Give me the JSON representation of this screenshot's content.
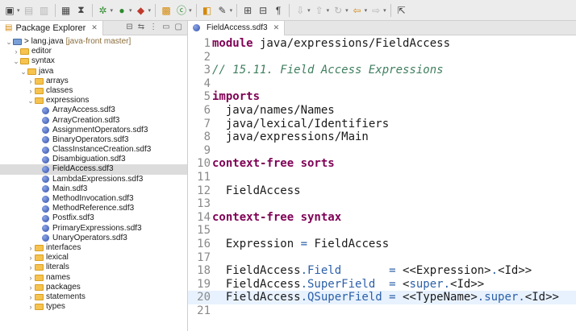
{
  "toolbar": {
    "icons": [
      "new-icon",
      "save-icon",
      "print-icon",
      "terminal-icon",
      "debug-icon",
      "run-icon",
      "external-tools-icon",
      "new-package-icon",
      "new-class-icon",
      "search-icon",
      "pen-icon",
      "open-type-icon",
      "toggle-icon",
      "pilcrow-icon",
      "annotation-icon",
      "back-icon",
      "forward-icon",
      "pin-icon"
    ]
  },
  "left_panel": {
    "tab_label": "Package Explorer",
    "tree": [
      {
        "depth": 0,
        "twisty": "v",
        "icon": "project",
        "label": "> lang.java",
        "extra": "[java-front master]"
      },
      {
        "depth": 1,
        "twisty": ">",
        "icon": "folder",
        "label": "editor"
      },
      {
        "depth": 1,
        "twisty": "v",
        "icon": "folder",
        "label": "syntax"
      },
      {
        "depth": 2,
        "twisty": "v",
        "icon": "folder",
        "label": "java"
      },
      {
        "depth": 3,
        "twisty": ">",
        "icon": "folder",
        "label": "arrays"
      },
      {
        "depth": 3,
        "twisty": ">",
        "icon": "folder",
        "label": "classes"
      },
      {
        "depth": 3,
        "twisty": "v",
        "icon": "folder",
        "label": "expressions"
      },
      {
        "depth": 4,
        "twisty": "",
        "icon": "sdf",
        "label": "ArrayAccess.sdf3"
      },
      {
        "depth": 4,
        "twisty": "",
        "icon": "sdf",
        "label": "ArrayCreation.sdf3"
      },
      {
        "depth": 4,
        "twisty": "",
        "icon": "sdf",
        "label": "AssignmentOperators.sdf3"
      },
      {
        "depth": 4,
        "twisty": "",
        "icon": "sdf",
        "label": "BinaryOperators.sdf3"
      },
      {
        "depth": 4,
        "twisty": "",
        "icon": "sdf",
        "label": "ClassInstanceCreation.sdf3"
      },
      {
        "depth": 4,
        "twisty": "",
        "icon": "sdf",
        "label": "Disambiguation.sdf3"
      },
      {
        "depth": 4,
        "twisty": "",
        "icon": "sdf",
        "label": "FieldAccess.sdf3",
        "selected": true
      },
      {
        "depth": 4,
        "twisty": "",
        "icon": "sdf",
        "label": "LambdaExpressions.sdf3"
      },
      {
        "depth": 4,
        "twisty": "",
        "icon": "sdf",
        "label": "Main.sdf3"
      },
      {
        "depth": 4,
        "twisty": "",
        "icon": "sdf",
        "label": "MethodInvocation.sdf3"
      },
      {
        "depth": 4,
        "twisty": "",
        "icon": "sdf",
        "label": "MethodReference.sdf3"
      },
      {
        "depth": 4,
        "twisty": "",
        "icon": "sdf",
        "label": "Postfix.sdf3"
      },
      {
        "depth": 4,
        "twisty": "",
        "icon": "sdf",
        "label": "PrimaryExpressions.sdf3"
      },
      {
        "depth": 4,
        "twisty": "",
        "icon": "sdf",
        "label": "UnaryOperators.sdf3"
      },
      {
        "depth": 3,
        "twisty": ">",
        "icon": "folder",
        "label": "interfaces"
      },
      {
        "depth": 3,
        "twisty": ">",
        "icon": "folder",
        "label": "lexical"
      },
      {
        "depth": 3,
        "twisty": ">",
        "icon": "folder",
        "label": "literals"
      },
      {
        "depth": 3,
        "twisty": ">",
        "icon": "folder",
        "label": "names"
      },
      {
        "depth": 3,
        "twisty": ">",
        "icon": "folder",
        "label": "packages"
      },
      {
        "depth": 3,
        "twisty": ">",
        "icon": "folder",
        "label": "statements"
      },
      {
        "depth": 3,
        "twisty": ">",
        "icon": "folder",
        "label": "types"
      }
    ]
  },
  "editor": {
    "tab_label": "FieldAccess.sdf3",
    "current_line": 20,
    "lines": [
      {
        "n": "1",
        "parts": [
          {
            "t": "module",
            "c": "kw"
          },
          {
            "t": " java/expressions/FieldAccess",
            "c": "tx"
          }
        ]
      },
      {
        "n": "2",
        "parts": []
      },
      {
        "n": "3",
        "parts": [
          {
            "t": "// 15.11. Field Access Expressions",
            "c": "cm"
          }
        ]
      },
      {
        "n": "4",
        "parts": []
      },
      {
        "n": "5",
        "parts": [
          {
            "t": "imports",
            "c": "kw"
          }
        ]
      },
      {
        "n": "6",
        "parts": [
          {
            "t": "  java/names/Names",
            "c": "tx"
          }
        ]
      },
      {
        "n": "7",
        "parts": [
          {
            "t": "  java/lexical/Identifiers",
            "c": "tx"
          }
        ]
      },
      {
        "n": "8",
        "parts": [
          {
            "t": "  java/expressions/Main",
            "c": "tx"
          }
        ]
      },
      {
        "n": "9",
        "parts": []
      },
      {
        "n": "10",
        "parts": [
          {
            "t": "context-free sorts",
            "c": "kw"
          }
        ]
      },
      {
        "n": "11",
        "parts": []
      },
      {
        "n": "12",
        "parts": [
          {
            "t": "  FieldAccess",
            "c": "tx"
          }
        ]
      },
      {
        "n": "13",
        "parts": []
      },
      {
        "n": "14",
        "parts": [
          {
            "t": "context-free syntax",
            "c": "kw"
          }
        ]
      },
      {
        "n": "15",
        "parts": []
      },
      {
        "n": "16",
        "parts": [
          {
            "t": "  Expression ",
            "c": "tx"
          },
          {
            "t": "=",
            "c": "blue"
          },
          {
            "t": " FieldAccess",
            "c": "tx"
          }
        ]
      },
      {
        "n": "17",
        "parts": []
      },
      {
        "n": "18",
        "parts": [
          {
            "t": "  FieldAccess",
            "c": "tx"
          },
          {
            "t": ".Field",
            "c": "blue"
          },
          {
            "t": "       ",
            "c": "tx"
          },
          {
            "t": "=",
            "c": "blue"
          },
          {
            "t": " <<Expression>",
            "c": "tx"
          },
          {
            "t": ".",
            "c": "blue"
          },
          {
            "t": "<Id>>",
            "c": "tx"
          }
        ]
      },
      {
        "n": "19",
        "parts": [
          {
            "t": "  FieldAccess",
            "c": "tx"
          },
          {
            "t": ".SuperField",
            "c": "blue"
          },
          {
            "t": "  ",
            "c": "tx"
          },
          {
            "t": "=",
            "c": "blue"
          },
          {
            "t": " <",
            "c": "tx"
          },
          {
            "t": "super.",
            "c": "blue"
          },
          {
            "t": "<Id>>",
            "c": "tx"
          }
        ]
      },
      {
        "n": "20",
        "parts": [
          {
            "t": "  FieldAccess",
            "c": "tx"
          },
          {
            "t": ".QSuperField",
            "c": "blue"
          },
          {
            "t": " ",
            "c": "tx"
          },
          {
            "t": "=",
            "c": "blue"
          },
          {
            "t": " <<TypeName>",
            "c": "tx"
          },
          {
            "t": ".super.",
            "c": "blue"
          },
          {
            "t": "<Id>>",
            "c": "tx"
          }
        ]
      },
      {
        "n": "21",
        "parts": []
      }
    ]
  }
}
